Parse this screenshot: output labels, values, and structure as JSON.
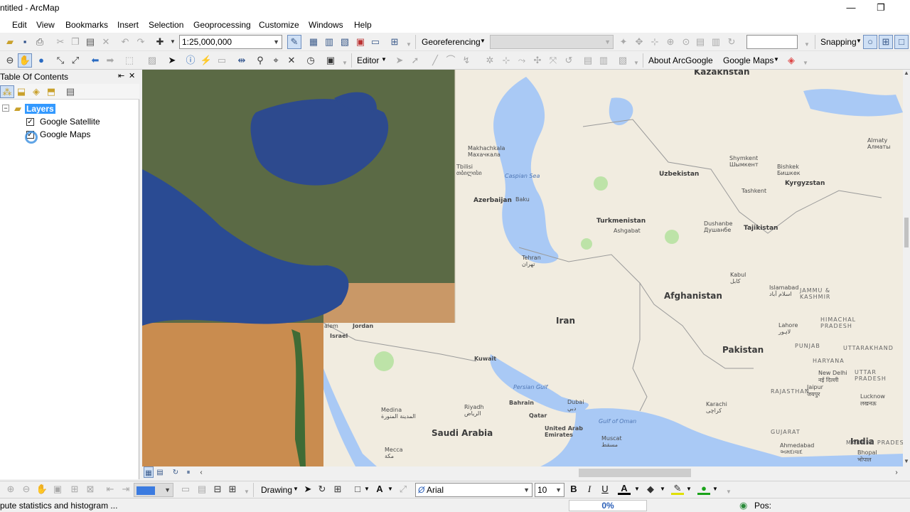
{
  "window": {
    "title": "ntitled - ArcMap",
    "minimize": "—",
    "restore": "❐",
    "close": "✕"
  },
  "menu": [
    "Edit",
    "View",
    "Bookmarks",
    "Insert",
    "Selection",
    "Geoprocessing",
    "Customize",
    "Windows",
    "Help"
  ],
  "toolbar1": {
    "scale": "1:25,000,000",
    "georeferencing_label": "Georeferencing",
    "georef_layer_value": "",
    "georef_search_value": "",
    "snapping_label": "Snapping"
  },
  "toolbar2": {
    "editor_label": "Editor",
    "about_label": "About ArcGoogle",
    "googlemaps_label": "Google Maps"
  },
  "toc": {
    "title": "Table Of Contents",
    "pin": "⇤",
    "close": "✕",
    "root_label": "Layers",
    "layers": [
      {
        "name": "Google Satellite",
        "checked": true
      },
      {
        "name": "Google Maps",
        "checked": true
      }
    ]
  },
  "map": {
    "countries": [
      "Kazakhstan",
      "Uzbekistan",
      "Kyrgyzstan",
      "Turkmenistan",
      "Tajikistan",
      "Azerbaijan",
      "Afghanistan",
      "Iran",
      "Pakistan",
      "Saudi Arabia",
      "India"
    ],
    "cities": {
      "almaty": "Almaty\nАлматы",
      "shymkent": "Shymkent\nШымкент",
      "bishkek": "Bishkek\nБишкек",
      "tashkent": "Tashkent",
      "dushanbe": "Dushanbe\nДушанбе",
      "ashgabat": "Ashgabat",
      "makhachkala": "Makhachkala\nМахачкала",
      "tbilisi": "Tbilisi\nთბილისი",
      "baku": "Baku",
      "tehran": "Tehran\nتهران",
      "kabul": "Kabul\nکابل",
      "islamabad": "Islamabad\nاسلام آباد",
      "lahore": "Lahore\nلاہور",
      "karachi": "Karachi\nکراچی",
      "jordan": "Jordan",
      "israel": "Israel",
      "salem": "alem",
      "kuwait": "Kuwait",
      "bahrain": "Bahrain",
      "qatar": "Qatar",
      "dubai": "Dubai\nدبي",
      "uae": "United Arab\nEmirates",
      "muscat": "Muscat\nمسقط",
      "riyadh": "Riyadh\nالرياض",
      "medina": "Medina\nالمدينة المنورة",
      "mecca": "Mecca\nمكة",
      "new_delhi": "New Delhi\nनई दिल्ली",
      "jaipur": "Jaipur\nजयपुर",
      "lucknow": "Lucknow\nलखनऊ",
      "ahmedabad": "Ahmedabad\nઅમદાવાદ",
      "bhopal": "Bhopal\nभोपाल"
    },
    "seas": {
      "caspian": "Caspian Sea",
      "persian": "Persian Gulf",
      "oman": "Gulf of Oman"
    },
    "regions": {
      "jk": "JAMMU & KASHMIR",
      "hp": "HIMACHAL PRADESH",
      "punjab": "PUNJAB",
      "uttarakhand": "UTTARAKHAND",
      "haryana": "HARYANA",
      "up": "UTTAR PRADESH",
      "rajasthan": "RAJASTHAN",
      "gujarat": "GUJARAT",
      "mp": "MADHYA PRADESH"
    }
  },
  "drawing": {
    "drawing_label": "Drawing",
    "font_name": "Arial",
    "font_size": "10",
    "bold": "B",
    "italic": "I",
    "underline": "U",
    "text_color": "A"
  },
  "status": {
    "message": "pute statistics and histogram ...",
    "progress": "0%",
    "pos_label": "Pos:"
  }
}
